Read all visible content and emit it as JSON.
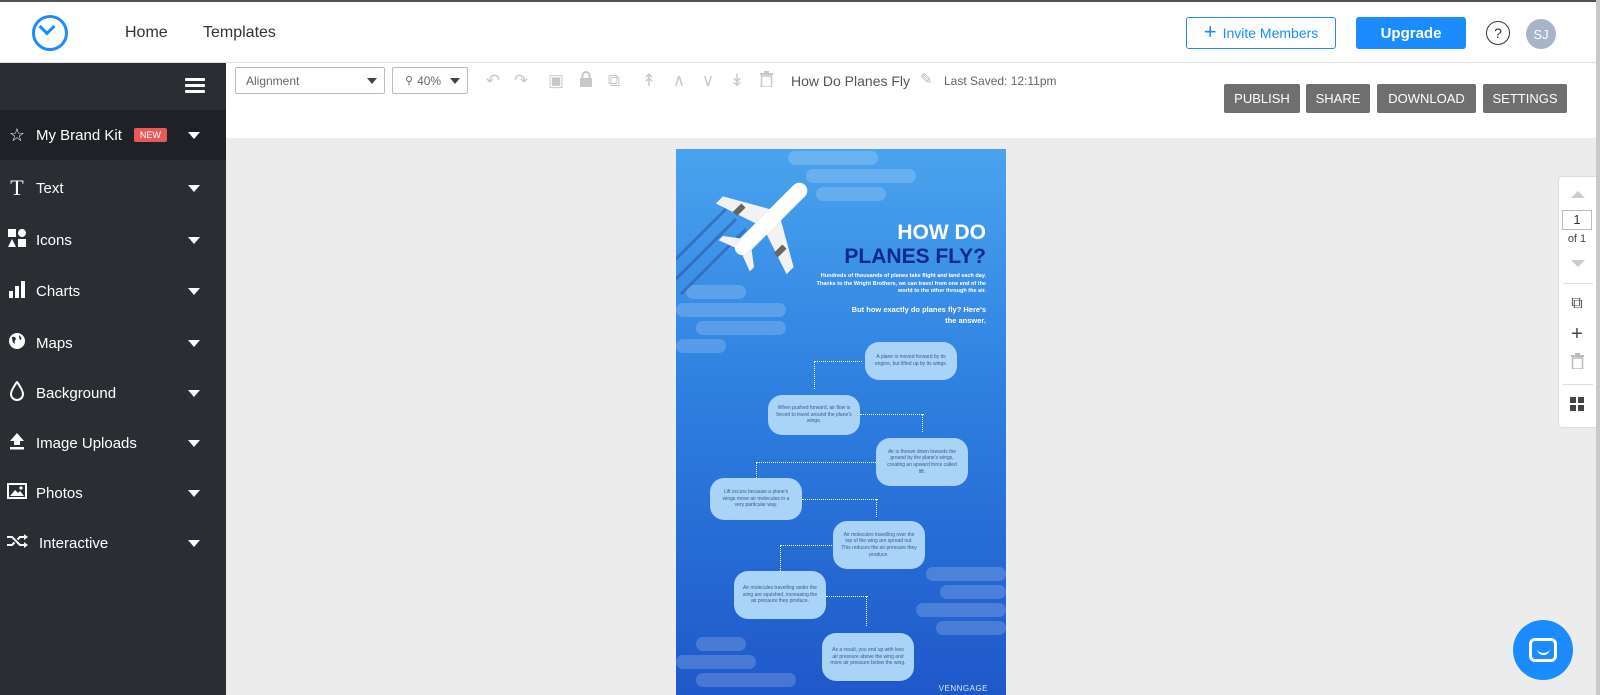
{
  "nav": {
    "links": [
      "Home",
      "Templates"
    ],
    "invite_label": "Invite Members",
    "upgrade_label": "Upgrade",
    "help_glyph": "?",
    "avatar_initials": "SJ"
  },
  "sidebar": {
    "items": [
      {
        "label": "My Brand Kit",
        "icon": "star-icon",
        "badge": "NEW"
      },
      {
        "label": "Text",
        "icon": "text-icon"
      },
      {
        "label": "Icons",
        "icon": "shapes-icon"
      },
      {
        "label": "Charts",
        "icon": "bar-chart-icon"
      },
      {
        "label": "Maps",
        "icon": "globe-icon"
      },
      {
        "label": "Background",
        "icon": "drop-icon"
      },
      {
        "label": "Image Uploads",
        "icon": "upload-icon"
      },
      {
        "label": "Photos",
        "icon": "photo-icon"
      },
      {
        "label": "Interactive",
        "icon": "shuffle-icon"
      }
    ]
  },
  "toolbar": {
    "alignment_label": "Alignment",
    "zoom_label": "40%",
    "doc_title": "How Do Planes Fly",
    "last_saved": "Last Saved: 12:11pm",
    "actions": [
      "PUBLISH",
      "SHARE",
      "DOWNLOAD",
      "SETTINGS"
    ]
  },
  "canvas": {
    "title_line1": "HOW DO",
    "title_line2": "PLANES FLY?",
    "intro": "Hundreds of thousands of planes take flight and land each day. Thanks to the Wright Brothers, we can travel from one end of the world to the other through the air.",
    "intro2": "But how exactly do planes fly? Here's the answer.",
    "steps": [
      "A plane is moved forward by its engine, but lifted up by its wings.",
      "When pushed forward, air flow is forced to travel around the plane's wings.",
      "Air is thrown down towards the ground by the plane's wings, creating an upward force called lift.",
      "Lift occurs because a plane's wings move air molecules in a very particular way.",
      "Air molecules travelling over the top of the wing are spread out. This reduces the air pressure they produce.",
      "Air molecules travelling under the wing are squished, increasing the air pressure they produce.",
      "As a result, you end up with less air pressure above the wing and more air pressure below the wing."
    ],
    "brand": "VENNGAGE"
  },
  "page_nav": {
    "current": "1",
    "of_label": "of 1"
  }
}
